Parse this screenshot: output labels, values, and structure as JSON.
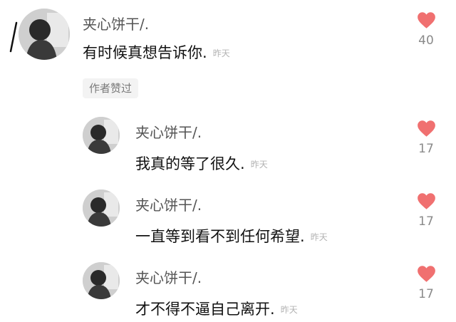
{
  "comments": [
    {
      "author": "夹心饼干/.",
      "text": "有时候真想告诉你.",
      "time": "昨天",
      "likes": "40",
      "author_liked_badge": "作者赞过"
    },
    {
      "author": "夹心饼干/.",
      "text": "我真的等了很久.",
      "time": "昨天",
      "likes": "17"
    },
    {
      "author": "夹心饼干/.",
      "text": "一直等到看不到任何希望.",
      "time": "昨天",
      "likes": "17"
    },
    {
      "author": "夹心饼干/.",
      "text": "才不得不逼自己离开.",
      "time": "昨天",
      "likes": "17"
    }
  ],
  "colors": {
    "heart": "#f07070",
    "time": "#b3b3b3",
    "name": "#555555"
  },
  "icons": {
    "like": "heart-icon"
  }
}
